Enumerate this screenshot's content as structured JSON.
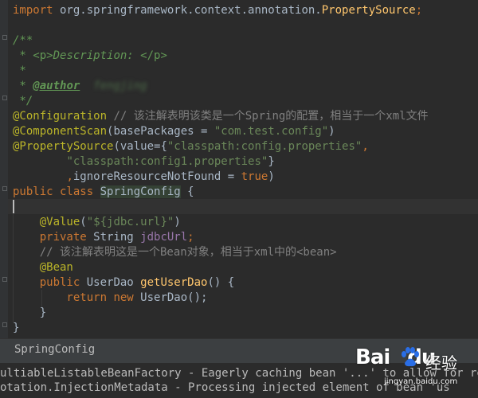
{
  "code": {
    "l1_kw": "import",
    "l1_pkg": " org.springframework.context.annotation.",
    "l1_cls": "PropertySource",
    "l1_end": ";",
    "l2_open": "/**",
    "l3_star": " * ",
    "l3_tag_open": "<p>",
    "l3_text": "Description: ",
    "l3_tag_close": "</p>",
    "l4_star": " *",
    "l5_star": " * ",
    "l5_author": "@author",
    "l5_name": "  fengjing",
    "l6_close": " */",
    "l7_ann": "@Configuration",
    "l7_comment": " // 该注解表明该类是一个Spring的配置，相当于一个xml文件",
    "l8_ann": "@ComponentScan",
    "l8_args_open": "(basePackages = ",
    "l8_str": "\"com.test.config\"",
    "l8_args_close": ")",
    "l9_ann": "@PropertySource",
    "l9_args_open": "(value={",
    "l9_str": "\"classpath:config.properties\"",
    "l9_comma": ",",
    "l10_indent": "        ",
    "l10_str": "\"classpath:config1.properties\"",
    "l10_close": "}",
    "l11_indent": "        ",
    "l11_comma": ",",
    "l11_param": "ignoreResourceNotFound = ",
    "l11_true": "true",
    "l11_close": ")",
    "l12_public": "public",
    "l12_class": " class ",
    "l12_name": "SpringConfig",
    "l12_brace": " {",
    "l14_ann": "    @Value",
    "l14_open": "(",
    "l14_str": "\"${jdbc.url}\"",
    "l14_close": ")",
    "l15_private": "    private",
    "l15_type": " String ",
    "l15_field": "jdbcUrl",
    "l15_end": ";",
    "l16_comment": "    // 该注解表明这是一个Bean对象，相当于xml中的<bean>",
    "l17_ann": "    @Bean",
    "l18_public": "    public",
    "l18_type": " UserDao ",
    "l18_method": "getUserDao",
    "l18_end": "() {",
    "l19_return": "        return",
    "l19_new": " new",
    "l19_end": " UserDao();",
    "l20_brace": "    }",
    "l21_brace": "}"
  },
  "breadcrumb": {
    "label": "SpringConfig"
  },
  "console": {
    "line1": "ultiableListableBeanFactory - Eagerly caching bean '...' to allow for resolving p",
    "line2": "otation.InjectionMetadata - Processing injected element of bean 'us"
  },
  "watermark": {
    "logo_text": "Bai",
    "logo_du": "du",
    "cn_text": "经验",
    "url": "jingyan.baidu.com"
  },
  "colors": {
    "editor_bg": "#2b2b2b",
    "keyword": "#cc7832",
    "annotation": "#bbb529",
    "string": "#6a8759",
    "comment": "#808080",
    "javadoc": "#629755",
    "field": "#9876aa",
    "method": "#ffc66d",
    "plain": "#a9b7c6"
  }
}
